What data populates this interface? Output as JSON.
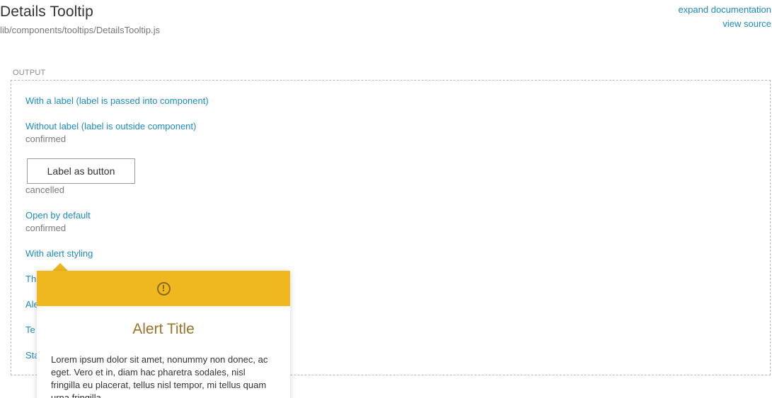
{
  "header": {
    "title": "Details Tooltip",
    "path": "lib/components/tooltips/DetailsTooltip.js",
    "expand_link": "expand documentation",
    "source_link": "view source"
  },
  "output": {
    "label": "OUTPUT",
    "examples": [
      {
        "link": "With a label (label is passed into component)"
      },
      {
        "link": "Without label (label is outside component)",
        "status": "confirmed"
      },
      {
        "button": "Label as button",
        "status": "cancelled"
      },
      {
        "link": "Open by default",
        "status": "confirmed"
      },
      {
        "link": "With alert styling"
      },
      {
        "link": "Th"
      },
      {
        "link": "Ale"
      },
      {
        "link": "Te"
      },
      {
        "link": "Sta"
      }
    ]
  },
  "tooltip": {
    "icon": "alert-circle-icon",
    "icon_glyph": "!",
    "title": "Alert Title",
    "body": "Lorem ipsum dolor sit amet, nonummy non donec, ac eget. Vero et in, diam hac pharetra sodales, nisl fringilla eu placerat, tellus nisl tempor, mi tellus quam urna fringilla"
  },
  "colors": {
    "link": "#1d8bc2",
    "alert_header": "#efb820",
    "alert_title": "#9a7428"
  }
}
